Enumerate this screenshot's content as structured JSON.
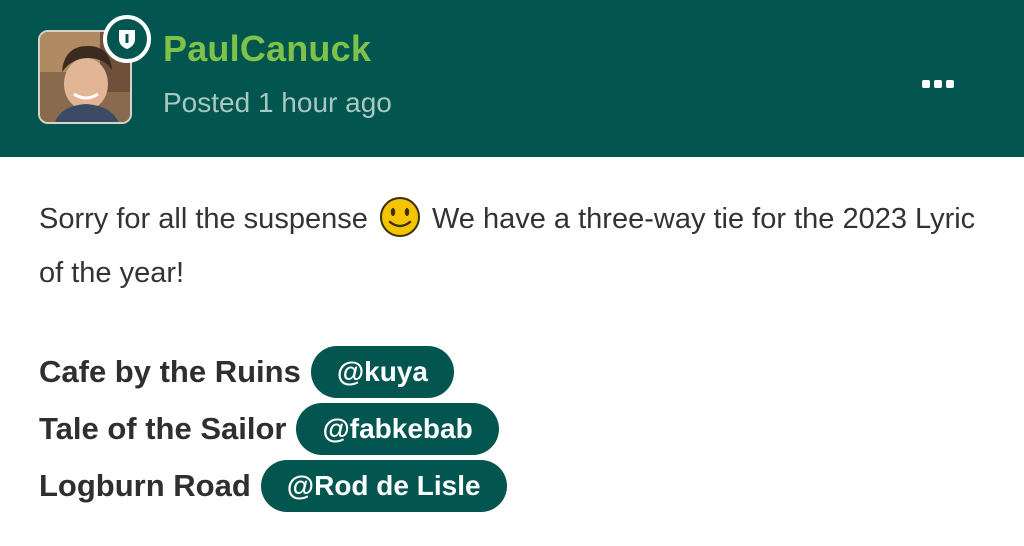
{
  "post": {
    "username": "PaulCanuck",
    "posted": "Posted 1 hour ago",
    "badge_icon": "shield-icon",
    "more_icon": "ellipsis-icon",
    "text_before_emoji": "Sorry for all the suspense",
    "emoji": "smiley-icon",
    "text_after_emoji": "We have a three-way tie for the 2023 Lyric of the year!",
    "entries": [
      {
        "title": "Cafe by the Ruins",
        "mention": "@kuya"
      },
      {
        "title": "Tale of the Sailor",
        "mention": "@fabkebab"
      },
      {
        "title": "Logburn Road",
        "mention": "@Rod de Lisle"
      }
    ]
  },
  "colors": {
    "header_bg": "#02564f",
    "username": "#7fc24a",
    "mention_bg": "#02564f"
  }
}
